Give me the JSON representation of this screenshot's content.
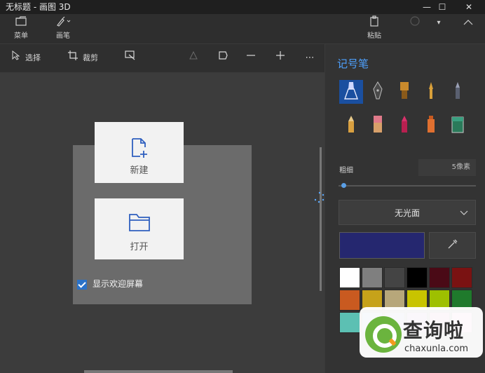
{
  "window": {
    "title": "无标题 - 画图 3D",
    "controls": {
      "minimize": "—",
      "maximize": "☐",
      "close": "✕"
    }
  },
  "ribbon": {
    "menu_label": "菜单",
    "brushes_label": "画笔",
    "paste_label": "粘贴"
  },
  "toolbar": {
    "select_label": "选择",
    "crop_label": "裁剪"
  },
  "welcome": {
    "new_label": "新建",
    "open_label": "打开",
    "show_welcome_label": "显示欢迎屏幕",
    "show_welcome_checked": true
  },
  "side_panel": {
    "title": "记号笔",
    "thickness_label": "粗细",
    "thickness_value": "5像素",
    "thickness_level": 0.02,
    "finish_label": "无光面",
    "brushes": [
      "marker",
      "calligraphy-pen",
      "oil-brush",
      "watercolor",
      "pixel-pen",
      "pencil",
      "eraser",
      "crayon",
      "spraycan",
      "fill"
    ],
    "selected_brush": "marker",
    "current_color": "#25276f",
    "palette": [
      "#ffffff",
      "#7f7f7f",
      "#444444",
      "#000000",
      "#4a0a16",
      "#7a1212",
      "#c95a20",
      "#c6a21a",
      "#b7a77a",
      "#c8c400",
      "#9ec000",
      "#1f7a2c",
      "#5cc0b3",
      "#3a6cb6",
      "#4a4fa0",
      "#7a3fa0",
      "#b03a7a",
      "#e06aa6"
    ]
  },
  "watermark": {
    "brand": "查询啦",
    "url": "chaxunla.com"
  }
}
